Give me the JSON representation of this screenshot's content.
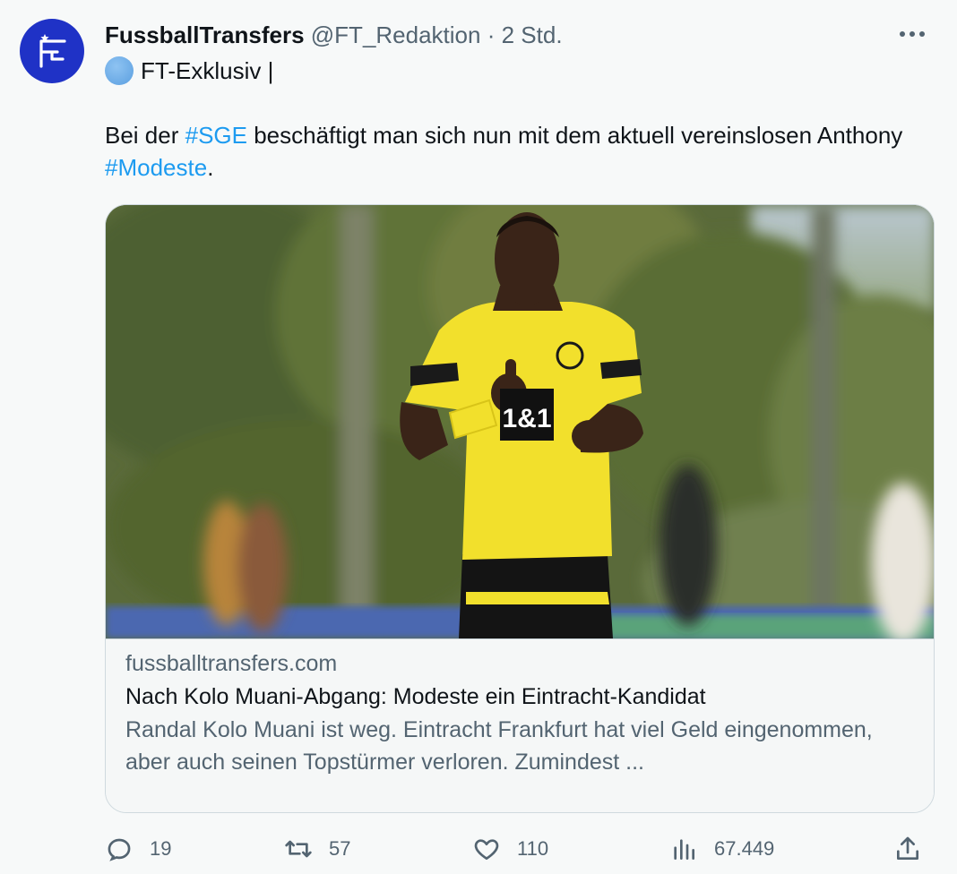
{
  "author": {
    "display_name": "FussballTransfers",
    "handle": "@FT_Redaktion",
    "separator": "·",
    "time": "2 Std."
  },
  "header_line2": "FT-Exklusiv |",
  "tweet_text": {
    "part1": "Bei der ",
    "hashtag1": "#SGE",
    "part2": " beschäftigt man sich nun mit dem aktuell vereinslosen Anthony ",
    "hashtag2": "#Modeste",
    "part3": "."
  },
  "card": {
    "domain": "fussballtransfers.com",
    "title": "Nach Kolo Muani-Abgang: Modeste ein Eintracht-Kandidat",
    "description": "Randal Kolo Muani ist weg. Eintracht Frankfurt hat viel Geld eingenommen, aber auch seinen Topstürmer verloren. Zumindest ...",
    "image_caption_text": "1&1"
  },
  "actions": {
    "replies": "19",
    "retweets": "57",
    "likes": "110",
    "views": "67.449"
  },
  "icons": {
    "avatar": "ft-logo-icon",
    "more": "more-horizontal-icon",
    "reply": "reply-icon",
    "retweet": "retweet-icon",
    "like": "heart-icon",
    "views": "analytics-icon",
    "share": "share-icon"
  },
  "colors": {
    "avatar_bg": "#1f32c6",
    "hashtag": "#1d9bf0",
    "secondary_text": "#536471",
    "jersey": "#f2e02c"
  }
}
